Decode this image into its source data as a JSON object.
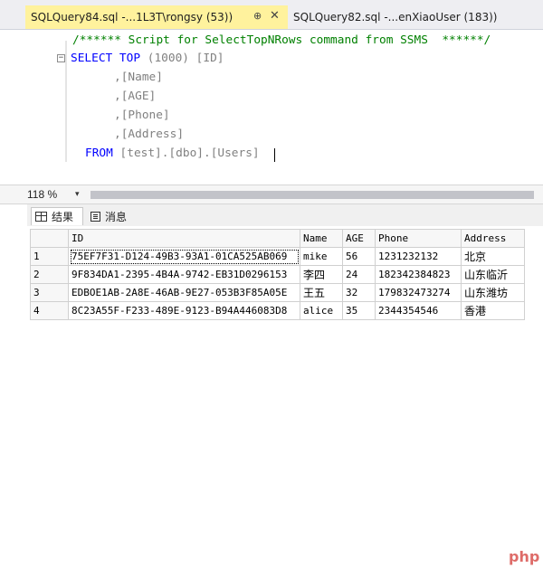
{
  "tabs": {
    "active_label": "SQLQuery84.sql -...1L3T\\rongsy (53))",
    "active_pin": "⊕",
    "active_close": "✕",
    "inactive_label": "SQLQuery82.sql -...enXiaoUser (183))"
  },
  "editor": {
    "comment": "/****** Script for SelectTopNRows command from SSMS  ******/",
    "fold_symbol": "⊟",
    "line_select_kw": "SELECT TOP",
    "line_select_rest": " (1000) [ID]",
    "col_name": ",[Name]",
    "col_age": ",[AGE]",
    "col_phone": ",[Phone]",
    "col_address": ",[Address]",
    "from_kw": "FROM",
    "from_rest": " [test].[dbo].[Users]"
  },
  "zoom": {
    "value": "118 %",
    "arrow": "▾"
  },
  "result_tabs": {
    "results_label": "结果",
    "messages_label": "消息"
  },
  "grid": {
    "columns": [
      "ID",
      "Name",
      "AGE",
      "Phone",
      "Address"
    ],
    "rows": [
      {
        "n": "1",
        "id": "75EF7F31-D124-49B3-93A1-01CA525AB069",
        "name": "mike",
        "age": "56",
        "phone": "1231232132",
        "address": "北京"
      },
      {
        "n": "2",
        "id": "9F834DA1-2395-4B4A-9742-EB31D0296153",
        "name": "李四",
        "age": "24",
        "phone": "182342384823",
        "address": "山东临沂"
      },
      {
        "n": "3",
        "id": "EDBOE1AB-2A8E-46AB-9E27-053B3F85A05E",
        "name": "王五",
        "age": "32",
        "phone": "179832473274",
        "address": "山东潍坊"
      },
      {
        "n": "4",
        "id": "8C23A55F-F233-489E-9123-B94A446083D8",
        "name": "alice",
        "age": "35",
        "phone": "2344354546",
        "address": "香港"
      }
    ]
  },
  "watermark": "php",
  "colors": {
    "active_tab": "#fff29d",
    "keyword": "#0000ff",
    "comment": "#008000"
  }
}
